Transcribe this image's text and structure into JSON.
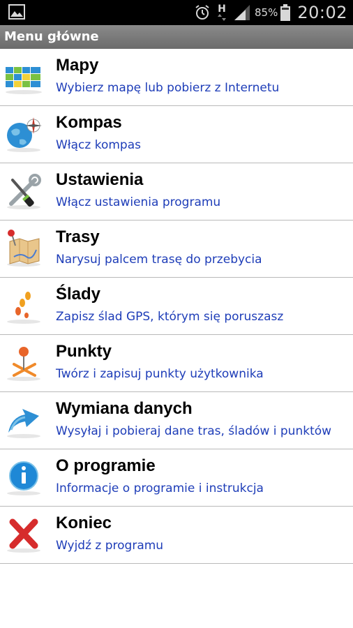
{
  "status_bar": {
    "icons": [
      "image-icon",
      "alarm-icon",
      "h-data-icon",
      "signal-icon",
      "battery-icon"
    ],
    "network_label": "H",
    "battery_percent": "85%",
    "time": "20:02"
  },
  "header": {
    "title": "Menu główne"
  },
  "menu": {
    "items": [
      {
        "title": "Mapy",
        "subtitle": "Wybierz mapę lub pobierz z Internetu",
        "icon": "maps-grid-icon"
      },
      {
        "title": "Kompas",
        "subtitle": "Włącz kompas",
        "icon": "compass-globe-icon"
      },
      {
        "title": "Ustawienia",
        "subtitle": "Włącz ustawienia programu",
        "icon": "tools-icon"
      },
      {
        "title": "Trasy",
        "subtitle": "Narysuj palcem trasę do przebycia",
        "icon": "route-map-icon"
      },
      {
        "title": "Ślady",
        "subtitle": "Zapisz ślad GPS, którym się poruszasz",
        "icon": "footprints-icon"
      },
      {
        "title": "Punkty",
        "subtitle": "Twórz i zapisuj punkty użytkownika",
        "icon": "waypoint-pin-icon"
      },
      {
        "title": "Wymiana danych",
        "subtitle": "Wysyłaj i pobieraj dane tras, śladów i punktów",
        "icon": "upload-arrow-icon"
      },
      {
        "title": "O programie",
        "subtitle": "Informacje o programie i instrukcja",
        "icon": "info-icon"
      },
      {
        "title": "Koniec",
        "subtitle": "Wyjdź z programu",
        "icon": "exit-x-icon"
      }
    ]
  },
  "colors": {
    "subtitle": "#1e3db8",
    "header_bg": "#777777",
    "divider": "#b9b9b9"
  }
}
